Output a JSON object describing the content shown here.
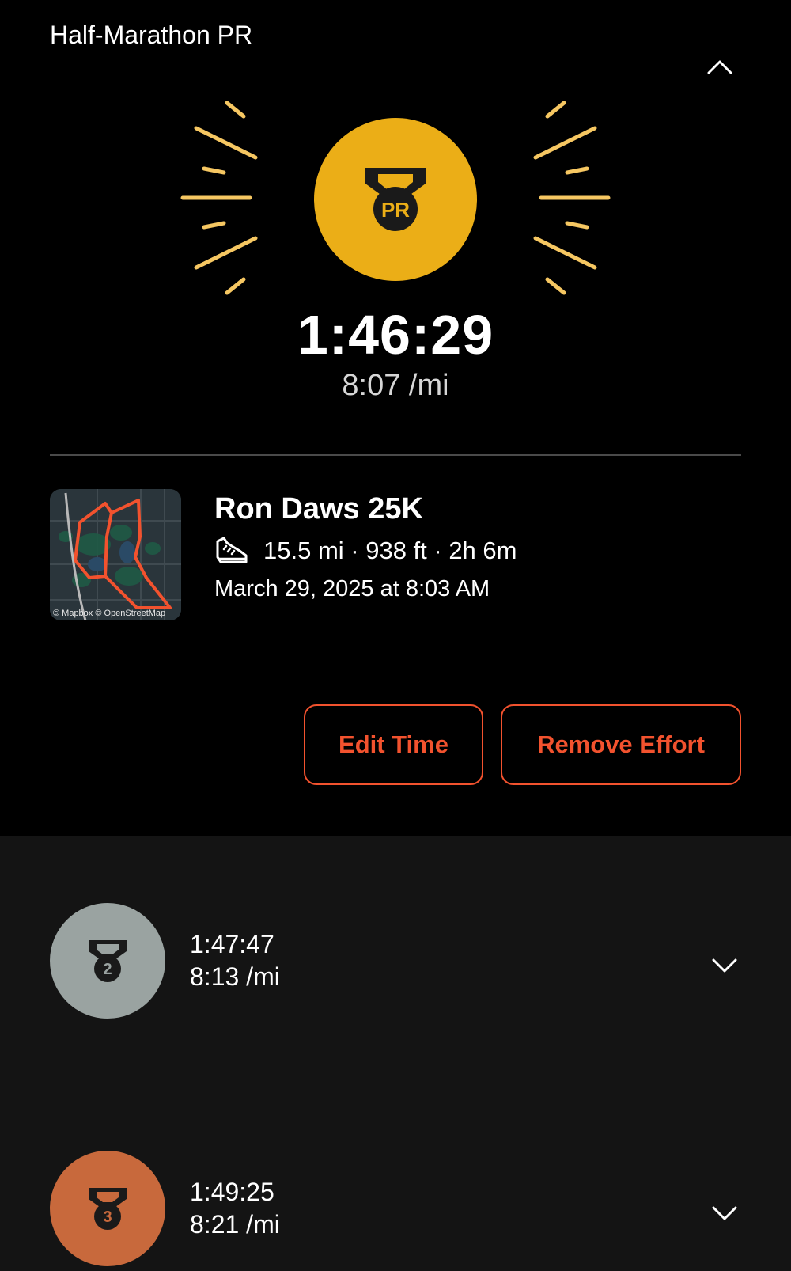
{
  "header": {
    "title": "Half-Marathon PR"
  },
  "colors": {
    "pr_gold": "#EBAE17",
    "silver": "#9AA3A1",
    "bronze": "#C8693C",
    "accent": "#F2522E"
  },
  "personal_record": {
    "badge_label": "PR",
    "time": "1:46:29",
    "pace": "8:07 /mi"
  },
  "activity": {
    "map_attribution": "© Mapbox © OpenStreetMap",
    "name": "Ron Daws 25K",
    "stats": "15.5 mi · 938 ft · 2h 6m",
    "date": "March 29, 2025 at 8:03 AM",
    "sport_icon": "running-shoe-icon"
  },
  "actions": {
    "edit_label": "Edit Time",
    "remove_label": "Remove Effort"
  },
  "efforts": [
    {
      "rank": "2",
      "time": "1:47:47",
      "pace": "8:13 /mi"
    },
    {
      "rank": "3",
      "time": "1:49:25",
      "pace": "8:21 /mi"
    }
  ]
}
